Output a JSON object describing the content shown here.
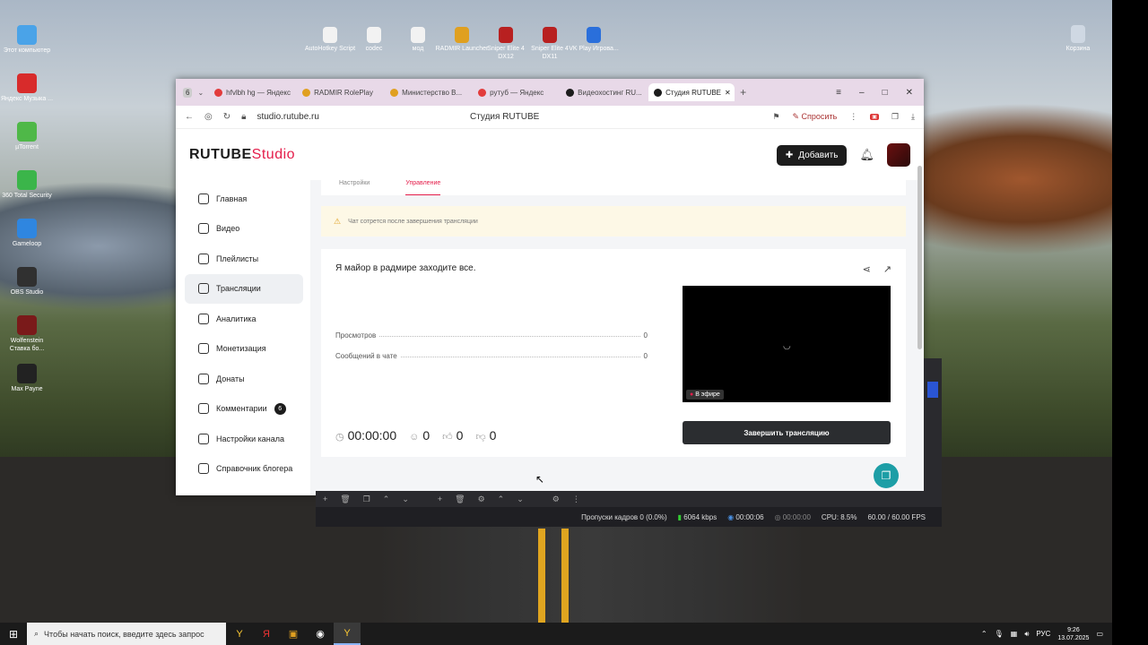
{
  "desktop": {
    "icons_left": [
      {
        "label": "Этот компьютер",
        "color": "#4aa3e8"
      },
      {
        "label": "Яндекс Музыка ...",
        "color": "#d82b2b"
      },
      {
        "label": "µTorrent",
        "color": "#4fb848"
      },
      {
        "label": "360 Total Security",
        "color": "#3bb54a"
      },
      {
        "label": "Gameloop",
        "color": "#2f86e0"
      },
      {
        "label": "OBS Studio",
        "color": "#303030"
      },
      {
        "label": "Wolfenstein Ставка бо...",
        "color": "#7a1a1a"
      },
      {
        "label": "Max Payne",
        "color": "#222222"
      }
    ],
    "icons_top": [
      {
        "label": "AutoHotkey Script",
        "color": "#f2f2f2"
      },
      {
        "label": "codec",
        "color": "#f2f2f2"
      },
      {
        "label": "мод",
        "color": "#f2f2f2"
      },
      {
        "label": "RADMIR Launcher",
        "color": "#e0a020"
      },
      {
        "label": "Sniper Elite 4 DX12",
        "color": "#b82020"
      },
      {
        "label": "Sniper Elite 4 DX11",
        "color": "#b82020"
      },
      {
        "label": "VK Play Игрова...",
        "color": "#2a6fdb"
      }
    ],
    "recycle_bin": "Корзина"
  },
  "browser": {
    "tab_count": "6",
    "tabs": [
      {
        "label": "hfvlbh hg — Яндекс",
        "active": false,
        "color": "#e23c3c"
      },
      {
        "label": "RADMIR RolePlay",
        "active": false,
        "color": "#e0a020"
      },
      {
        "label": "Министерство В...",
        "active": false,
        "color": "#e0a020"
      },
      {
        "label": "рутуб — Яндекс",
        "active": false,
        "color": "#e23c3c"
      },
      {
        "label": "Видеохостинг RU...",
        "active": false,
        "color": "#1c1c1c"
      },
      {
        "label": "Студия RUTUBE",
        "active": true,
        "color": "#1c1c1c"
      }
    ],
    "url": "studio.rutube.ru",
    "page_title": "Студия RUTUBE",
    "ask_label": "Спросить"
  },
  "studio": {
    "logo_main": "RUTUBE",
    "logo_sub": "Studio",
    "add_button": "Добавить",
    "nav": [
      {
        "label": "Главная",
        "active": false
      },
      {
        "label": "Видео",
        "active": false
      },
      {
        "label": "Плейлисты",
        "active": false
      },
      {
        "label": "Трансляции",
        "active": true
      },
      {
        "label": "Аналитика",
        "active": false
      },
      {
        "label": "Монетизация",
        "active": false
      },
      {
        "label": "Донаты",
        "active": false
      },
      {
        "label": "Комментарии",
        "active": false,
        "badge": "6"
      },
      {
        "label": "Настройки канала",
        "active": false
      },
      {
        "label": "Справочник блогера",
        "active": false
      }
    ],
    "subtabs": {
      "settings": "Настройки",
      "manage": "Управление"
    },
    "notice": "Чат сотрется после завершения трансляции",
    "stream": {
      "title": "Я майор в радмире заходите все.",
      "views_label": "Просмотров",
      "views_value": "0",
      "messages_label": "Сообщений в чате",
      "messages_value": "0",
      "live_label": "В эфире",
      "end_button": "Завершить трансляцию",
      "duration": "00:00:00",
      "viewers": "0",
      "likes": "0",
      "dislikes": "0"
    }
  },
  "obs": {
    "dropped_frames": "Пропуски кадров 0 (0.0%)",
    "bitrate": "6064 kbps",
    "stream_time": "00:00:06",
    "rec_time": "00:00:00",
    "cpu": "CPU: 8.5%",
    "fps": "60.00 / 60.00 FPS"
  },
  "taskbar": {
    "search_placeholder": "Чтобы начать поиск, введите здесь запрос",
    "lang": "РУС",
    "time": "9:26",
    "date": "13.07.2025"
  }
}
